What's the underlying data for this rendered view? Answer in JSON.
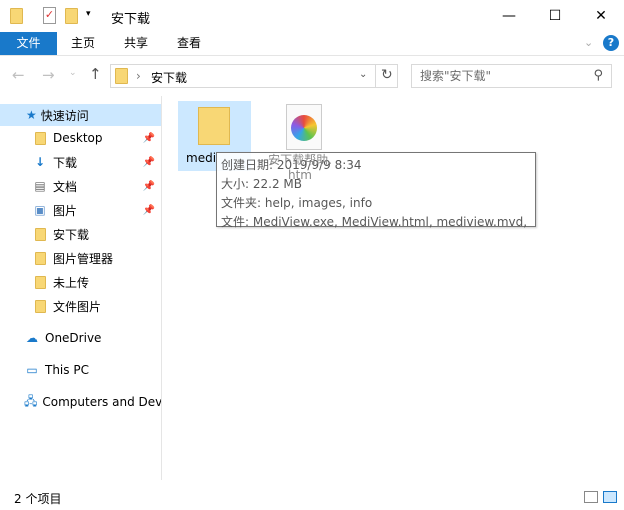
{
  "window": {
    "title": "安下载",
    "minimize": "—",
    "maximize": "☐",
    "close": "✕"
  },
  "ribbon": {
    "tabs": [
      "文件",
      "主页",
      "共享",
      "查看"
    ],
    "help": "?",
    "accent": "#1979ca"
  },
  "address": {
    "path": "安下载",
    "search_placeholder": "搜索\"安下载\""
  },
  "nav": {
    "quick_access": "快速访问",
    "items": [
      {
        "label": "Desktop",
        "icon": "folder-icon",
        "pinned": true
      },
      {
        "label": "下载",
        "icon": "download-icon",
        "pinned": true
      },
      {
        "label": "文档",
        "icon": "document-icon",
        "pinned": true
      },
      {
        "label": "图片",
        "icon": "picture-icon",
        "pinned": true
      },
      {
        "label": "安下载",
        "icon": "folder-icon",
        "pinned": false
      },
      {
        "label": "图片管理器",
        "icon": "folder-icon",
        "pinned": false
      },
      {
        "label": "未上传",
        "icon": "folder-icon",
        "pinned": false
      },
      {
        "label": "文件图片",
        "icon": "folder-icon",
        "pinned": false
      }
    ],
    "onedrive": "OneDrive",
    "thispc": "This PC",
    "network": "Computers and Dev"
  },
  "files": [
    {
      "name": "medi",
      "type": "folder"
    },
    {
      "name": "安下载帮助.htm",
      "type": "htm"
    }
  ],
  "tooltip": {
    "lines": [
      "创建日期: 2019/9/9 8:34",
      "大小: 22.2 MB",
      "文件夹: help, images, info",
      "文件: MediView.exe, MediView.html, mediview.mvd, ..."
    ]
  },
  "status": {
    "count": "2 个项目"
  }
}
